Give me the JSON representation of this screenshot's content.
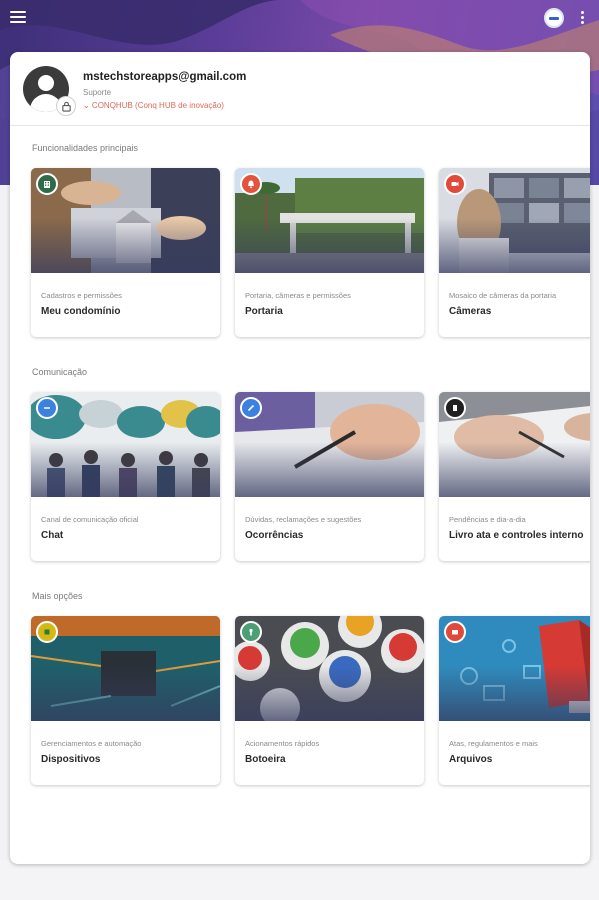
{
  "profile": {
    "email": "mstechstoreapps@gmail.com",
    "role": "Suporte",
    "condominium": "⌄ CONQHUB (Conq HUB de inovação)"
  },
  "sections": [
    {
      "title": "Funcionalidades principais",
      "cards": [
        {
          "subtitle": "Cadastros e permissões",
          "title": "Meu condomínio",
          "icon": "building-icon",
          "accent": "#2f6b48"
        },
        {
          "subtitle": "Portaria, câmeras e permissões",
          "title": "Portaria",
          "icon": "bell-icon",
          "accent": "#e2543d"
        },
        {
          "subtitle": "Mosaico de câmeras da portaria",
          "title": "Câmeras",
          "icon": "camera-icon",
          "accent": "#e04a3a"
        }
      ]
    },
    {
      "title": "Comunicação",
      "cards": [
        {
          "subtitle": "Canal de comunicação oficial",
          "title": "Chat",
          "icon": "chat-icon",
          "accent": "#3b82e0"
        },
        {
          "subtitle": "Dúvidas, reclamações e sugestões",
          "title": "Ocorrências",
          "icon": "pencil-icon",
          "accent": "#3b82e0"
        },
        {
          "subtitle": "Pendências e dia-a-dia",
          "title": "Livro ata e controles interno",
          "icon": "book-icon",
          "accent": "#1f1f1f"
        }
      ]
    },
    {
      "title": "Mais opções",
      "cards": [
        {
          "subtitle": "Gerenciamentos e automação",
          "title": "Dispositivos",
          "icon": "chip-icon",
          "accent": "#d4b814"
        },
        {
          "subtitle": "Acionamentos rápidos",
          "title": "Botoeira",
          "icon": "touch-icon",
          "accent": "#4aa074"
        },
        {
          "subtitle": "Atas, regulamentos e mais",
          "title": "Arquivos",
          "icon": "folder-icon",
          "accent": "#e04a3a"
        }
      ]
    }
  ]
}
